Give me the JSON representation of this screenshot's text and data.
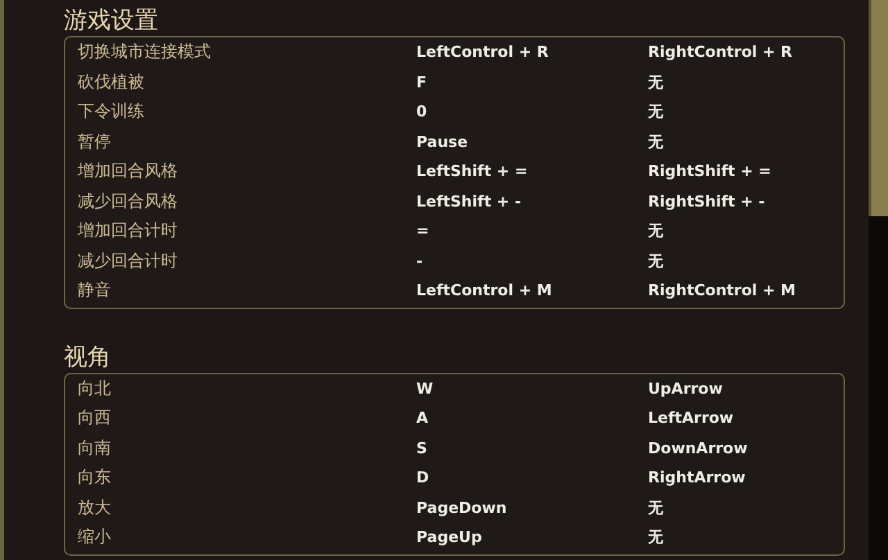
{
  "sections": [
    {
      "title": "游戏设置",
      "rows": [
        {
          "action": "切换城市连接模式",
          "key": "LeftControl + R",
          "alt_key": "RightControl + R"
        },
        {
          "action": "砍伐植被",
          "key": "F",
          "alt_key": "无"
        },
        {
          "action": "下令训练",
          "key": "0",
          "alt_key": "无"
        },
        {
          "action": "暂停",
          "key": "Pause",
          "alt_key": "无"
        },
        {
          "action": "增加回合风格",
          "key": "LeftShift + =",
          "alt_key": "RightShift + ="
        },
        {
          "action": "减少回合风格",
          "key": "LeftShift + -",
          "alt_key": "RightShift + -"
        },
        {
          "action": "增加回合计时",
          "key": "=",
          "alt_key": "无"
        },
        {
          "action": "减少回合计时",
          "key": "-",
          "alt_key": "无"
        },
        {
          "action": "静音",
          "key": "LeftControl + M",
          "alt_key": "RightControl + M"
        }
      ]
    },
    {
      "title": "视角",
      "rows": [
        {
          "action": "向北",
          "key": "W",
          "alt_key": "UpArrow"
        },
        {
          "action": "向西",
          "key": "A",
          "alt_key": "LeftArrow"
        },
        {
          "action": "向南",
          "key": "S",
          "alt_key": "DownArrow"
        },
        {
          "action": "向东",
          "key": "D",
          "alt_key": "RightArrow"
        },
        {
          "action": "放大",
          "key": "PageDown",
          "alt_key": "无"
        },
        {
          "action": "缩小",
          "key": "PageUp",
          "alt_key": "无"
        }
      ]
    }
  ]
}
